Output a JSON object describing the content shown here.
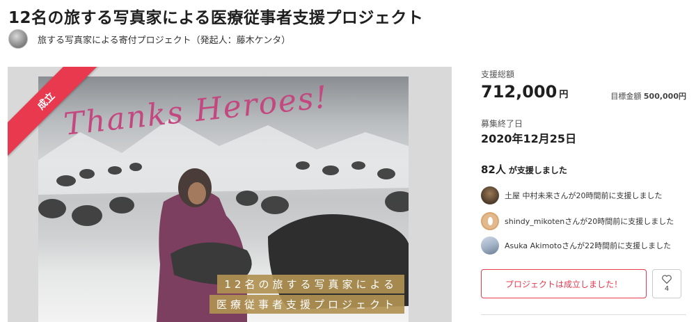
{
  "page": {
    "title": "12名の旅する写真家による医療従事者支援プロジェクト",
    "owner_label": "旅する写真家による寄付プロジェクト（発起人：藤木ケンタ）"
  },
  "hero": {
    "badge": "成立",
    "script_text": "Thanks Heroes!",
    "caption_line1": "12名の旅する写真家による",
    "caption_line2": "医療従事者支援プロジェクト"
  },
  "sidebar": {
    "total_label": "支援総額",
    "total_value": "712,000",
    "total_unit": "円",
    "goal_label": "目標金額",
    "goal_value": "500,000円",
    "end_label": "募集終了日",
    "end_value": "2020年12月25日",
    "backers_count": "82人",
    "backers_suffix": "が支援しました",
    "supporters": [
      {
        "text": "土屋 中村未来さんが20時間前に支援しました"
      },
      {
        "text": "shindy_mikotenさんが20時間前に支援しました"
      },
      {
        "text": "Asuka Akimotoさんが22時間前に支援しました"
      }
    ],
    "cta_label": "プロジェクトは成立しました！",
    "favorite_count": "4",
    "favorite_icon": "heart-icon"
  },
  "colors": {
    "accent": "#e8394f",
    "caption_bg": "#b09152",
    "script": "#c2487f"
  }
}
